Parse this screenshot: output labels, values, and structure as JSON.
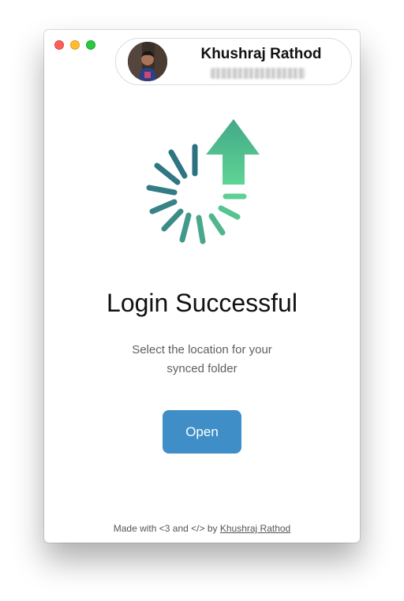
{
  "profile": {
    "name": "Khushraj Rathod",
    "email": "redacted"
  },
  "main": {
    "title": "Login Successful",
    "subtitle": "Select the location for your synced folder",
    "open_label": "Open"
  },
  "footer": {
    "prefix": "Made with <3 and </> by ",
    "author_link": "Khushraj Rathod"
  },
  "colors": {
    "accent_button": "#3f8ec8",
    "gradient_start": "#2e7180",
    "gradient_end": "#5fd593"
  },
  "icons": [
    "loading-spinner-upload-icon",
    "avatar"
  ]
}
